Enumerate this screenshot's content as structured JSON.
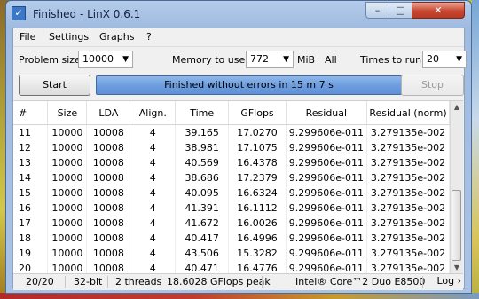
{
  "window": {
    "title": "Finished - LinX 0.6.1",
    "min": "–",
    "max": "□",
    "close": "✕"
  },
  "menu": [
    "File",
    "Settings",
    "Graphs",
    "?"
  ],
  "controls": {
    "problem_size_label": "Problem size:",
    "problem_size_value": "10000",
    "memory_label": "Memory to use:",
    "memory_value": "772",
    "memory_unit": "MiB",
    "memory_all": "All",
    "times_label": "Times to run:",
    "times_value": "20",
    "start_label": "Start",
    "stop_label": "Stop",
    "status_message": "Finished without errors in 15 m 7 s",
    "progress_fraction": 1.0
  },
  "table": {
    "columns": [
      "#",
      "Size",
      "LDA",
      "Align.",
      "Time",
      "GFlops",
      "Residual",
      "Residual (norm)"
    ],
    "rows": [
      [
        "11",
        "10000",
        "10008",
        "4",
        "39.165",
        "17.0270",
        "9.299606e-011",
        "3.279135e-002"
      ],
      [
        "12",
        "10000",
        "10008",
        "4",
        "38.981",
        "17.1075",
        "9.299606e-011",
        "3.279135e-002"
      ],
      [
        "13",
        "10000",
        "10008",
        "4",
        "40.569",
        "16.4378",
        "9.299606e-011",
        "3.279135e-002"
      ],
      [
        "14",
        "10000",
        "10008",
        "4",
        "38.686",
        "17.2379",
        "9.299606e-011",
        "3.279135e-002"
      ],
      [
        "15",
        "10000",
        "10008",
        "4",
        "40.095",
        "16.6324",
        "9.299606e-011",
        "3.279135e-002"
      ],
      [
        "16",
        "10000",
        "10008",
        "4",
        "41.391",
        "16.1112",
        "9.299606e-011",
        "3.279135e-002"
      ],
      [
        "17",
        "10000",
        "10008",
        "4",
        "41.672",
        "16.0026",
        "9.299606e-011",
        "3.279135e-002"
      ],
      [
        "18",
        "10000",
        "10008",
        "4",
        "40.417",
        "16.4996",
        "9.299606e-011",
        "3.279135e-002"
      ],
      [
        "19",
        "10000",
        "10008",
        "4",
        "43.506",
        "15.3282",
        "9.299606e-011",
        "3.279135e-002"
      ],
      [
        "20",
        "10000",
        "10008",
        "4",
        "40.471",
        "16.4776",
        "9.299606e-011",
        "3.279135e-002"
      ]
    ]
  },
  "status": {
    "runs": "20/20",
    "bits": "32-bit",
    "threads": "2 threads",
    "peak": "18.6028 GFlops peak",
    "cpu": "Intel® Core™2 Duo E8500",
    "log": "Log ›"
  }
}
